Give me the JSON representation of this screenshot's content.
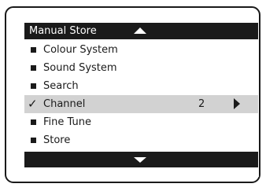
{
  "menu": {
    "title": "Manual Store",
    "items": [
      {
        "label": "Colour System",
        "marker": "bullet",
        "selected": false
      },
      {
        "label": "Sound System",
        "marker": "bullet",
        "selected": false
      },
      {
        "label": "Search",
        "marker": "bullet",
        "selected": false
      },
      {
        "label": "Channel",
        "marker": "check",
        "check_glyph": "✓",
        "value": "2",
        "selected": true
      },
      {
        "label": "Fine Tune",
        "marker": "bullet",
        "selected": false
      },
      {
        "label": "Store",
        "marker": "bullet",
        "selected": false
      }
    ],
    "icons": {
      "scroll_up": "arrow-up-icon",
      "scroll_down": "arrow-down-icon",
      "submenu": "arrow-right-icon"
    },
    "colors": {
      "bar": "#1a1a1a",
      "selected_row": "#d2d2d2",
      "text": "#1a1a1a",
      "bar_text": "#ffffff"
    }
  }
}
